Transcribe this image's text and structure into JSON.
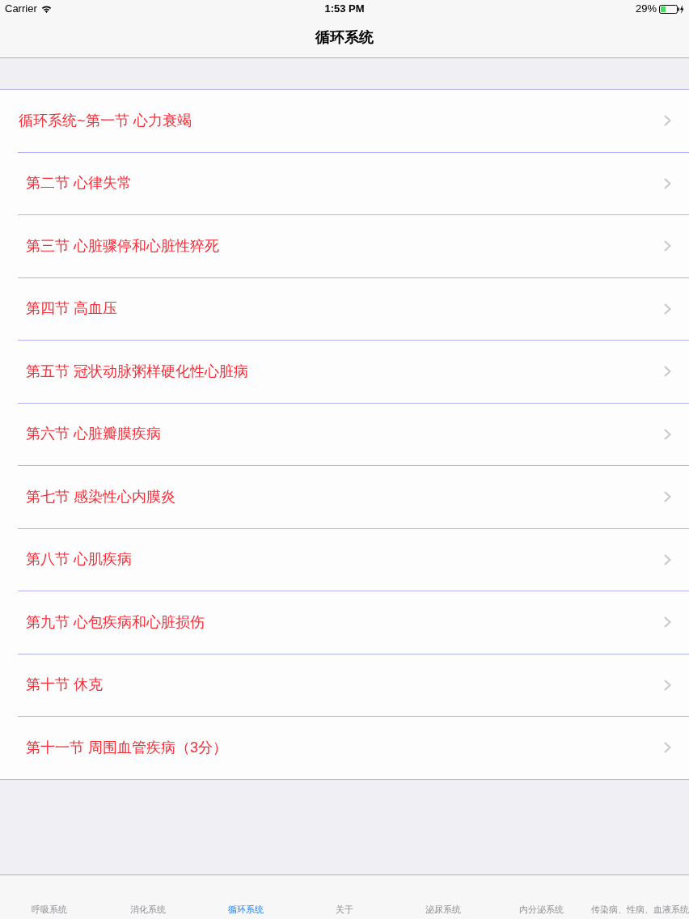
{
  "status_bar": {
    "carrier": "Carrier",
    "time": "1:53 PM",
    "battery_percent": "29%"
  },
  "nav_bar": {
    "title": "循环系统"
  },
  "list": {
    "items": [
      {
        "label": "循环系统~第一节 心力衰竭"
      },
      {
        "label": "第二节 心律失常"
      },
      {
        "label": "第三节 心脏骤停和心脏性猝死"
      },
      {
        "label": "第四节 高血压"
      },
      {
        "label": "第五节 冠状动脉粥样硬化性心脏病"
      },
      {
        "label": "第六节 心脏瓣膜疾病"
      },
      {
        "label": "第七节 感染性心内膜炎"
      },
      {
        "label": "第八节 心肌疾病"
      },
      {
        "label": "第九节 心包疾病和心脏损伤"
      },
      {
        "label": "第十节 休克"
      },
      {
        "label": "第十一节 周围血管疾病（3分）"
      }
    ]
  },
  "tab_bar": {
    "tabs": [
      {
        "label": "呼吸系统",
        "selected": false
      },
      {
        "label": "消化系统",
        "selected": false
      },
      {
        "label": "循环系统",
        "selected": true
      },
      {
        "label": "关于",
        "selected": false
      },
      {
        "label": "泌尿系统",
        "selected": false
      },
      {
        "label": "内分泌系统",
        "selected": false
      },
      {
        "label": "传染病、性病、血液系统",
        "selected": false
      }
    ]
  }
}
